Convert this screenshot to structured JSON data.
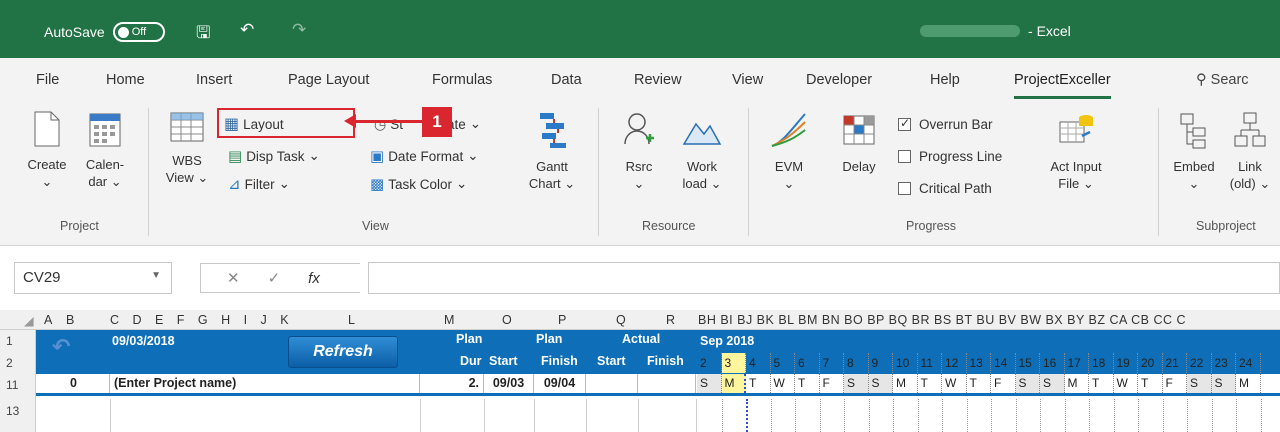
{
  "titlebar": {
    "autosave_label": "AutoSave",
    "autosave_state": "Off",
    "app_name": "Excel",
    "accent": "#217346"
  },
  "tabs": [
    "File",
    "Home",
    "Insert",
    "Page Layout",
    "Formulas",
    "Data",
    "Review",
    "View",
    "Developer",
    "Help",
    "ProjectExceller"
  ],
  "active_tab": "ProjectExceller",
  "search_label": "Searc",
  "ribbon": {
    "project": {
      "create": "Create",
      "calendar1": "Calen-",
      "calendar2": "dar",
      "label": "Project"
    },
    "view": {
      "wbs1": "WBS",
      "wbs2": "View",
      "layout": "Layout",
      "disp_task": "Disp Task",
      "filter": "Filter",
      "status_date_a": "St",
      "status_date_b": "ate",
      "date_format": "Date Format",
      "task_color": "Task Color",
      "gantt1": "Gantt",
      "gantt2": "Chart",
      "label": "View"
    },
    "resource": {
      "rsrc": "Rsrc",
      "work1": "Work",
      "work2": "load",
      "label": "Resource"
    },
    "progress": {
      "evm": "EVM",
      "delay": "Delay",
      "overrun": "Overrun Bar",
      "progress_line": "Progress Line",
      "critical_path": "Critical Path",
      "act1": "Act Input",
      "act2": "File",
      "label": "Progress"
    },
    "subproject": {
      "embed": "Embed",
      "link1": "Link",
      "link2": "(old)",
      "label": "Subproject"
    },
    "callout_number": "1",
    "callout_color": "#d9262f"
  },
  "formula_bar": {
    "name_box": "CV29",
    "fx": "fx",
    "value": ""
  },
  "sheet": {
    "columns": [
      "A",
      "B",
      "C",
      "D",
      "E",
      "F",
      "G",
      "H",
      "I",
      "J",
      "K",
      "L",
      "M",
      "O",
      "P",
      "Q",
      "R"
    ],
    "gantt_columns": "BH BI BJ BK BL BM BN BO BP BQ BR BS BT BU BV BW BX BY BZ CA CB CC C",
    "rows": [
      "1",
      "2",
      "11",
      "13"
    ],
    "date": "09/03/2018",
    "refresh": "Refresh",
    "plan_dur_1": "Plan",
    "plan_dur_2": "Dur",
    "plan": "Plan",
    "start": "Start",
    "finish": "Finish",
    "actual": "Actual",
    "a_start": "Start",
    "a_finish": "Finish",
    "month": "Sep 2018",
    "days": [
      "2",
      "3",
      "4",
      "5",
      "6",
      "7",
      "8",
      "9",
      "10",
      "11",
      "12",
      "13",
      "14",
      "15",
      "16",
      "17",
      "18",
      "19",
      "20",
      "21",
      "22",
      "23",
      "24"
    ],
    "weekdays": [
      "S",
      "M",
      "T",
      "W",
      "T",
      "F",
      "S",
      "S",
      "M",
      "T",
      "W",
      "T",
      "F",
      "S",
      "S",
      "M",
      "T",
      "W",
      "T",
      "F",
      "S",
      "S",
      "M"
    ],
    "row11": {
      "b": "0",
      "name": "(Enter Project name)",
      "dur": "2.",
      "start": "09/03",
      "finish": "09/04"
    },
    "band_color": "#0e6fb8"
  }
}
